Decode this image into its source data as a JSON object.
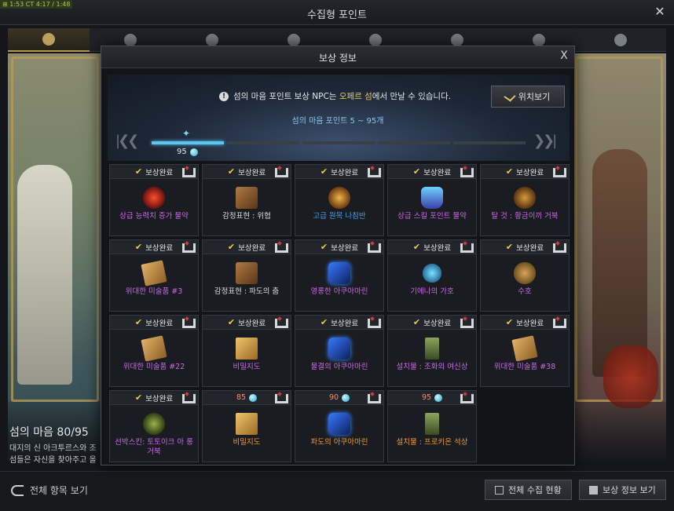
{
  "window": {
    "title": "수집형 포인트",
    "close": "✕",
    "status_mini": "⊞ 1:53  CT 4:17 / 1:48"
  },
  "categories": [
    {
      "name": "island-heart",
      "active": true
    },
    {
      "name": "orpheus-star"
    },
    {
      "name": "giant-heart"
    },
    {
      "name": "art"
    },
    {
      "name": "sea-bounty"
    },
    {
      "name": "ignea"
    },
    {
      "name": "leaf"
    },
    {
      "name": "telescope"
    }
  ],
  "island": {
    "title": "섬의 마음 80/95",
    "desc_line1": "대지의 신 아크투르스와 조",
    "desc_line2": "섬들은 자신을 찾아주고 올"
  },
  "bottom": {
    "view_all": "전체 항목 보기",
    "collect_status": "전체 수집 현황",
    "reward_info": "보상 정보 보기"
  },
  "modal": {
    "title": "보상 정보",
    "close": "X",
    "notice_prefix": "섬의 마음 포인트 보상 NPC는 ",
    "notice_npc": "오페르 섬",
    "notice_suffix": "에서 만날 수 있습니다.",
    "location_button": "위치보기",
    "points_range": "섬의 마음 포인트 5 ~ 95개",
    "milestone_value": "95",
    "progress_filled_segments": 1,
    "progress_total_segments": 5
  },
  "rewards": [
    {
      "status": "보상완료",
      "name": "상급 능력치 증가 물약",
      "color": "purple",
      "icon": "potion-red-icon"
    },
    {
      "status": "보상완료",
      "name": "감정표현 : 위협",
      "color": "white",
      "icon": "book-icon"
    },
    {
      "status": "보상완료",
      "name": "고급 원목 나침반",
      "color": "blue",
      "icon": "compass-icon"
    },
    {
      "status": "보상완료",
      "name": "상급 스킬 포인트 물약",
      "color": "purple",
      "icon": "flask-icon"
    },
    {
      "status": "보상완료",
      "name": "탈 것 : 황금이끼 거북",
      "color": "purple",
      "icon": "mount-icon"
    },
    {
      "status": "보상완료",
      "name": "위대한 미술품 #3",
      "color": "purple",
      "icon": "map-icon"
    },
    {
      "status": "보상완료",
      "name": "감정표현 : 파도의 춤",
      "color": "white",
      "icon": "book-icon"
    },
    {
      "status": "보상완료",
      "name": "영롱한 아쿠아마린",
      "color": "purple",
      "icon": "card-icon"
    },
    {
      "status": "보상완료",
      "name": "기에나의 가호",
      "color": "purple",
      "icon": "orb-icon"
    },
    {
      "status": "보상완료",
      "name": "수호",
      "color": "purple",
      "icon": "coin-icon"
    },
    {
      "status": "보상완료",
      "name": "위대한 미술품 #22",
      "color": "purple",
      "icon": "map-icon"
    },
    {
      "status": "보상완료",
      "name": "비밀지도",
      "color": "purple",
      "icon": "map-gold-icon"
    },
    {
      "status": "보상완료",
      "name": "물결의 아쿠아마린",
      "color": "purple",
      "icon": "card-icon"
    },
    {
      "status": "보상완료",
      "name": "설치물 : 조화의 여신상",
      "color": "purple",
      "icon": "statue-icon"
    },
    {
      "status": "보상완료",
      "name": "위대한 미술품 #38",
      "color": "purple",
      "icon": "map-icon"
    },
    {
      "status": "보상완료",
      "name": "선박스킨: 토토이크 아 롱거북",
      "color": "purple",
      "icon": "tree-icon"
    },
    {
      "status": "85",
      "name": "비밀지도",
      "color": "orange",
      "icon": "map-gold-icon",
      "pending": true
    },
    {
      "status": "90",
      "name": "파도의 아쿠아마린",
      "color": "orange",
      "icon": "card-icon",
      "pending": true
    },
    {
      "status": "95",
      "name": "설치물 : 프로키온 석상",
      "color": "orange",
      "icon": "statue-icon",
      "pending": true
    }
  ]
}
